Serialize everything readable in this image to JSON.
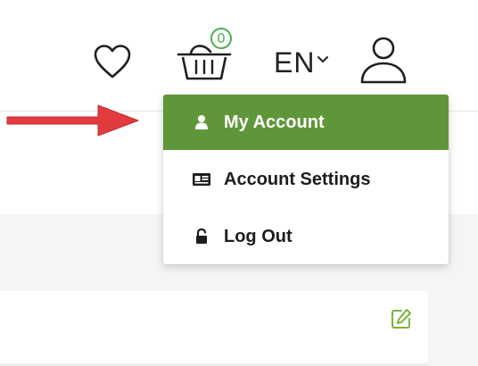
{
  "header": {
    "cart_count": "0",
    "language": "EN"
  },
  "account_menu": {
    "items": [
      {
        "label": "My Account",
        "icon": "user-icon",
        "active": true
      },
      {
        "label": "Account Settings",
        "icon": "id-card-icon",
        "active": false
      },
      {
        "label": "Log Out",
        "icon": "unlock-icon",
        "active": false
      }
    ]
  },
  "colors": {
    "accent_green": "#5f963a",
    "annotation_red": "#e23b3f",
    "badge_green": "#4caf50"
  }
}
